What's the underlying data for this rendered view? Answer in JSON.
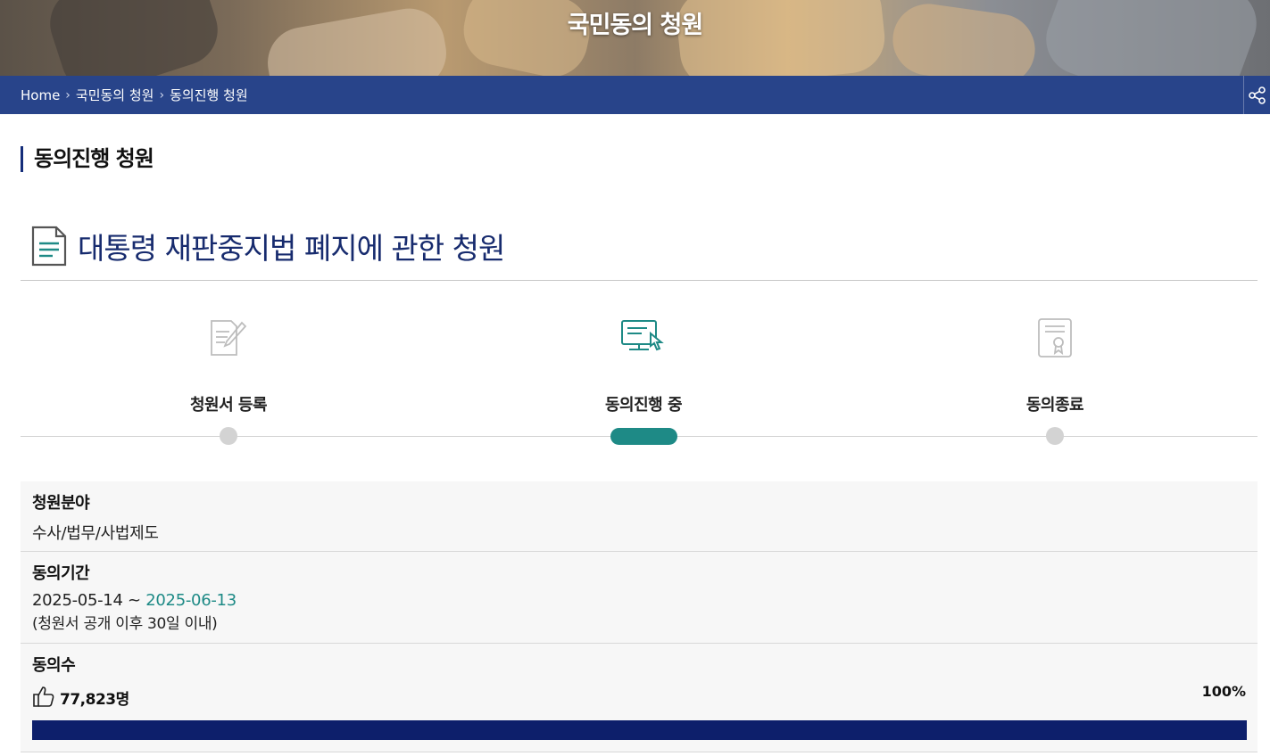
{
  "header": {
    "title": "국민동의 청원"
  },
  "breadcrumb": [
    "Home",
    "국민동의 청원",
    "동의진행 청원"
  ],
  "section": {
    "title": "동의진행 청원"
  },
  "petition": {
    "title": "대통령 재판중지법 폐지에 관한 청원"
  },
  "steps": [
    {
      "label": "청원서 등록",
      "icon": "pencil-document-icon",
      "active": false
    },
    {
      "label": "동의진행 중",
      "icon": "monitor-click-icon",
      "active": true
    },
    {
      "label": "동의종료",
      "icon": "certificate-icon",
      "active": false
    }
  ],
  "info": {
    "field_label": "청원분야",
    "field_value": "수사/법무/사법제도",
    "period_label": "동의기간",
    "period_start": "2025-05-14",
    "period_sep": " ~ ",
    "period_end": "2025-06-13",
    "period_note": "(청원서 공개 이후 30일 이내)",
    "count_label": "동의수",
    "count_value": "77,823명",
    "percent_label": "100%",
    "progress": 1.0
  },
  "colors": {
    "navy": "#152d7a",
    "teal": "#1e8a86",
    "progress": "#0d1f6b"
  }
}
